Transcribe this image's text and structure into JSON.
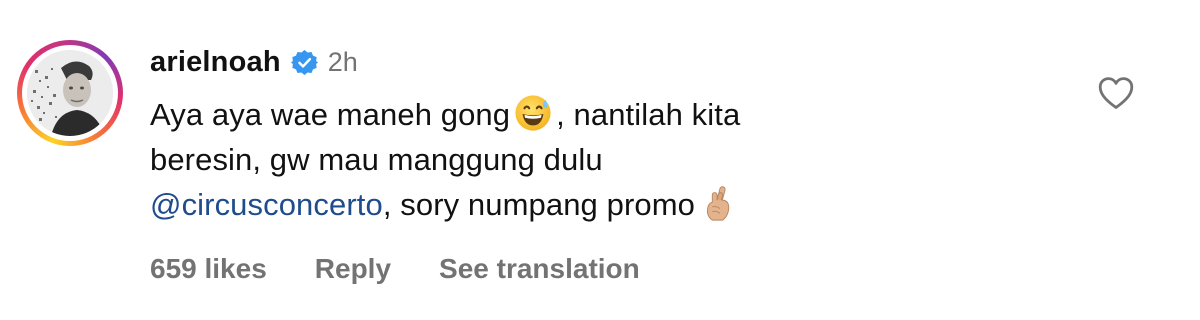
{
  "comment": {
    "username": "arielnoah",
    "time": "2h",
    "body": {
      "line1_a": "Aya aya wae maneh gong",
      "line1_emoji": "grinning-face-with-sweat",
      "line1_b": ", nantilah kita",
      "line2": "beresin, gw mau manggung dulu",
      "line3_mention": "@circusconcerto",
      "line3_b": ", sory numpang promo",
      "line3_emoji": "crossed-fingers-medium-light-skin"
    },
    "footer": {
      "likes": "659 likes",
      "reply": "Reply",
      "translation": "See translation"
    }
  },
  "colors": {
    "text": "#111111",
    "secondary": "#737373",
    "mention": "#1f4c8c",
    "verified": "#3797f0"
  }
}
